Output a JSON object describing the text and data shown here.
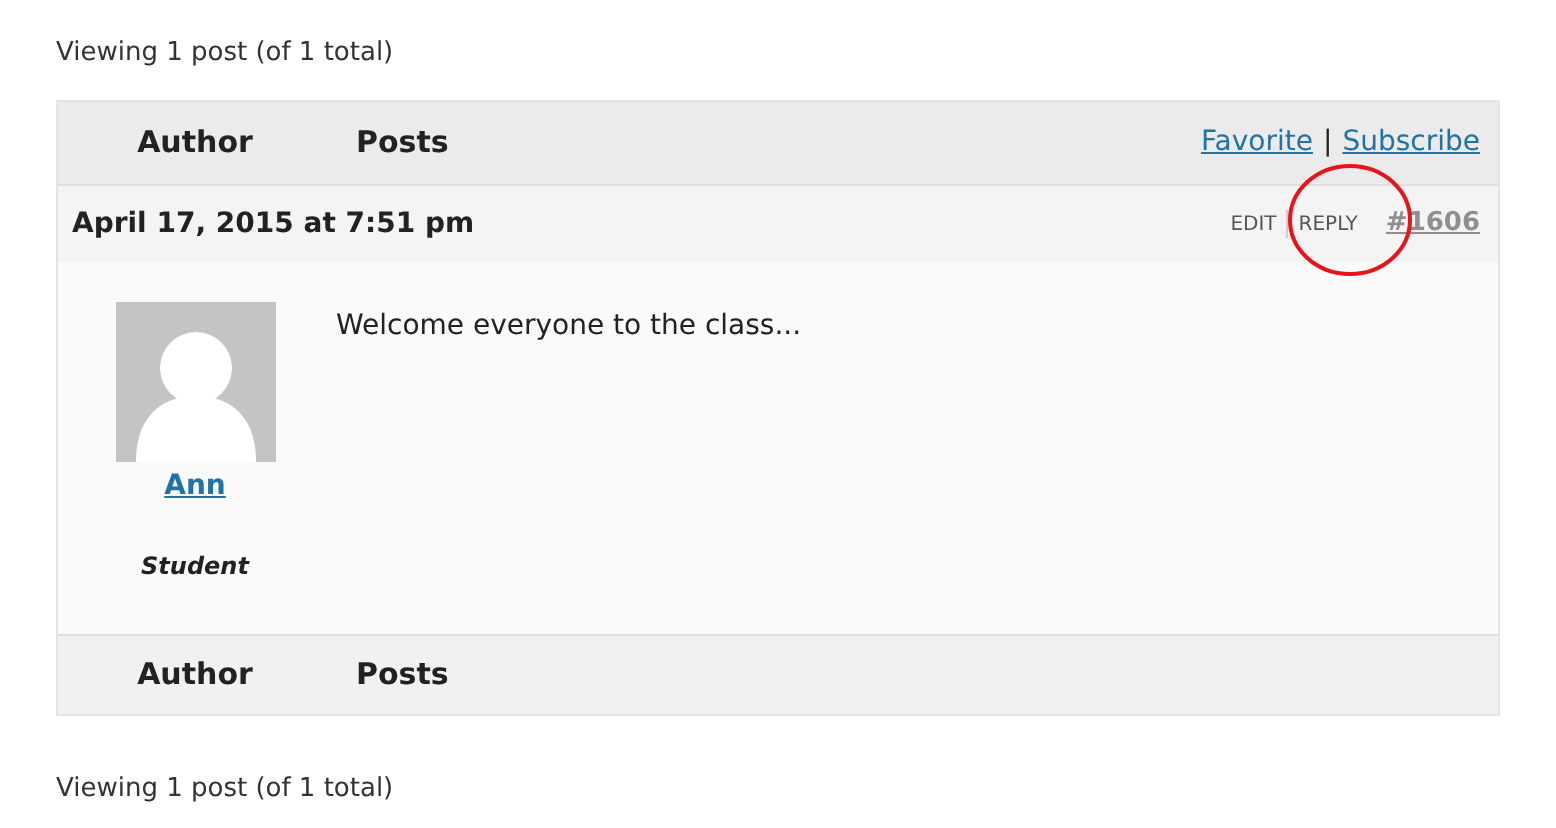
{
  "pagination_top": "Viewing 1 post (of 1 total)",
  "header": {
    "columns": [
      "Author",
      "Posts"
    ],
    "links": [
      "Favorite",
      "Subscribe"
    ],
    "separator": "|"
  },
  "posts": [
    {
      "date": "April 17, 2015 at 7:51 pm",
      "actions": [
        "EDIT",
        "REPLY"
      ],
      "permalink": "#1606",
      "reply_circled": true,
      "author": "Ann",
      "role": "Student",
      "content": "Welcome everyone to the class..."
    }
  ],
  "footer": {
    "columns": [
      "Author",
      "Posts"
    ]
  },
  "pagination_bottom": "Viewing 1 post (of 1 total)"
}
